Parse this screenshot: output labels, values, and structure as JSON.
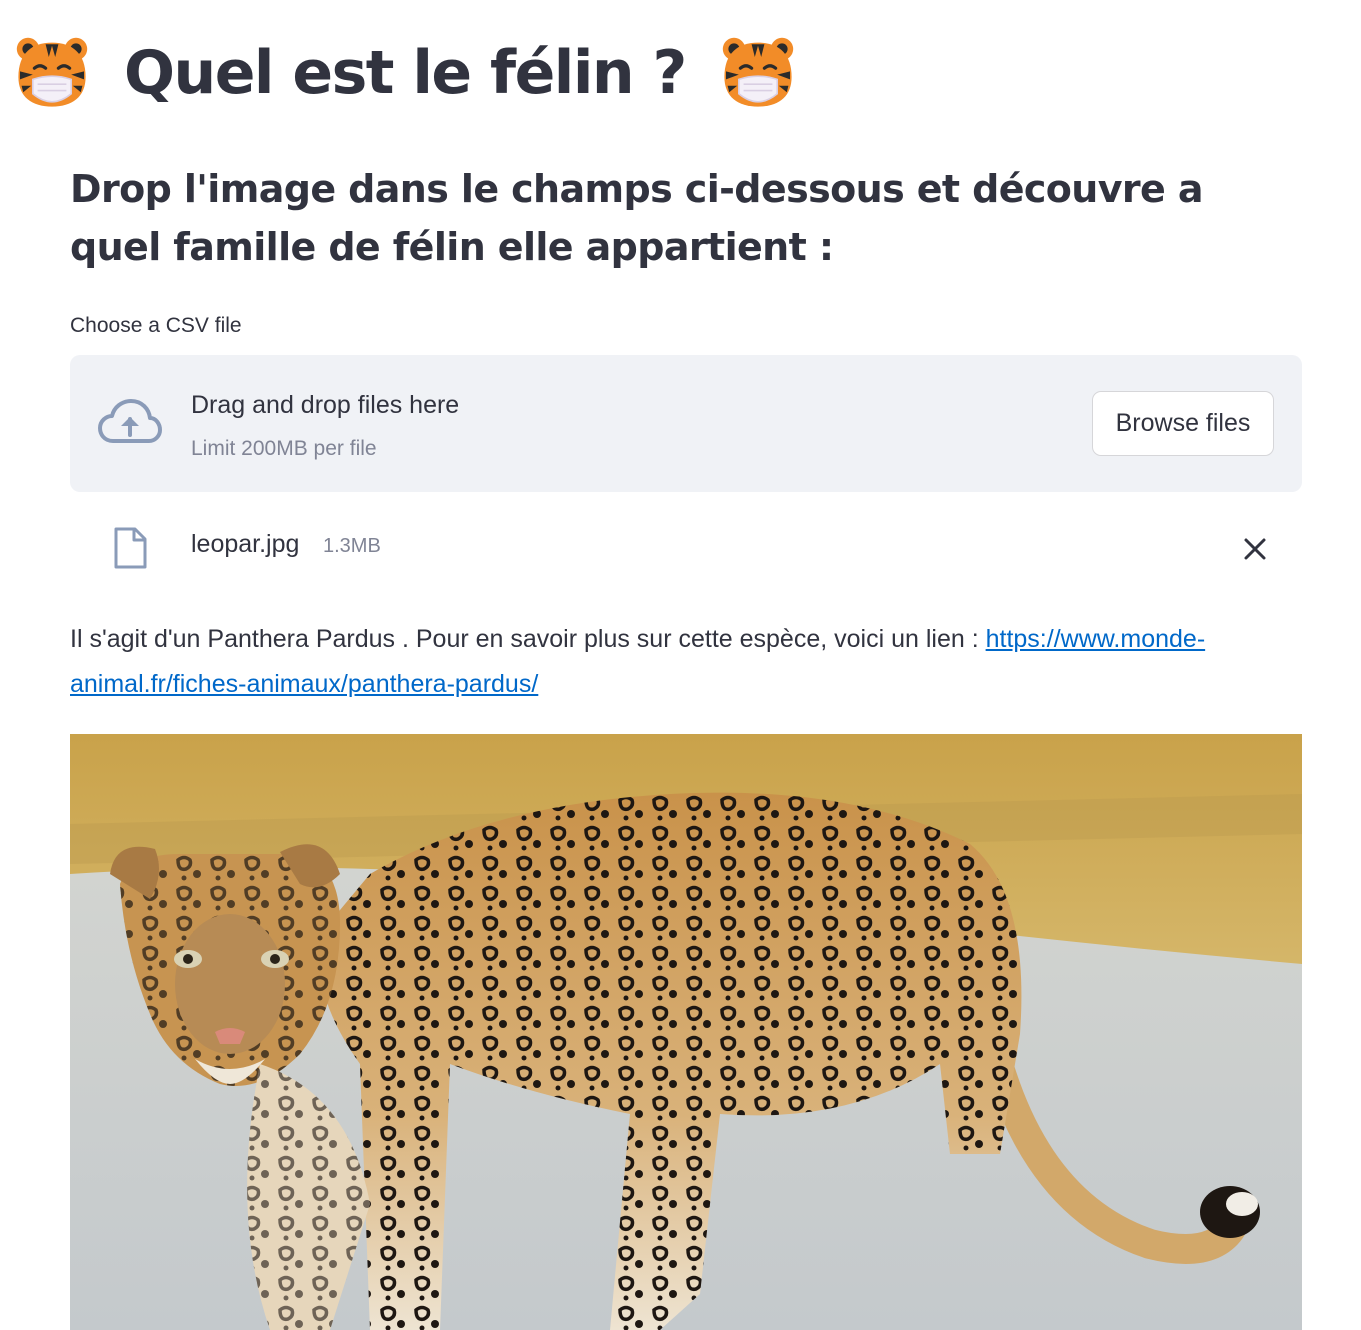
{
  "header": {
    "title": "Quel est le félin ?",
    "title_icon": "tiger-face-icon"
  },
  "subtitle": "Drop l'image dans le champs ci-dessous et découvre a quel famille de félin elle appartient :",
  "uploader": {
    "label": "Choose a CSV file",
    "instructions": "Drag and drop files here",
    "limit": "Limit 200MB per file",
    "browse_label": "Browse files",
    "icon": "cloud-upload-icon"
  },
  "uploaded_file": {
    "name": "leopar.jpg",
    "size": "1.3MB",
    "icon": "file-icon",
    "remove_icon": "close-icon"
  },
  "result": {
    "text": "Il s'agit d'un Panthera Pardus . Pour en savoir plus sur cette espèce, voici un lien : ",
    "link_text": "https://www.monde-animal.fr/fiches-animaux/panthera-pardus/",
    "link_href": "https://www.monde-animal.fr/fiches-animaux/panthera-pardus/"
  },
  "image": {
    "subject": "leopard"
  },
  "colors": {
    "text": "#31333f",
    "muted": "#808495",
    "dropzone_bg": "#f0f2f6",
    "link": "#0068c9"
  }
}
